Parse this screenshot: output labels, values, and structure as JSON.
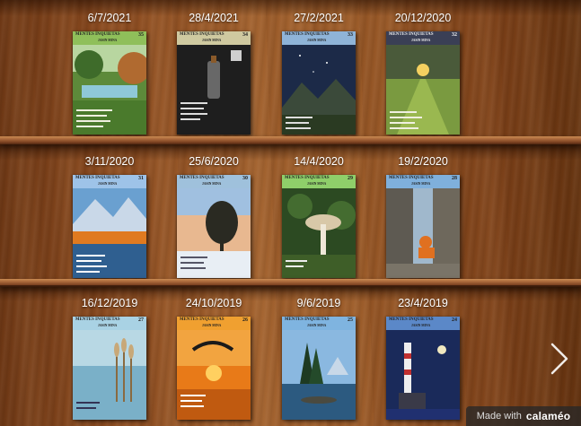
{
  "shelves": [
    {
      "books": [
        {
          "date": "6/7/2021",
          "title": "MENTES INQUIETAS",
          "author": "JASIN MINA",
          "number": "35",
          "head": "#8fbf5a",
          "scene": "garden"
        },
        {
          "date": "28/4/2021",
          "title": "MENTES INQUIETAS",
          "author": "JASIN MINA",
          "number": "34",
          "head": "#cfc9a0",
          "scene": "bottle"
        },
        {
          "date": "27/2/2021",
          "title": "MENTES INQUIETAS",
          "author": "JASIN MINA",
          "number": "33",
          "head": "#8fb4d8",
          "scene": "mountains-night"
        },
        {
          "date": "20/12/2020",
          "title": "MENTES INQUIETAS",
          "author": "JASIN MINA",
          "number": "32",
          "head": "#3a3f55",
          "scene": "field-sunset"
        }
      ]
    },
    {
      "books": [
        {
          "date": "3/11/2020",
          "title": "MENTES INQUIETAS",
          "author": "JASIN MINA",
          "number": "31",
          "head": "#9ec3e8",
          "scene": "autumn-lake"
        },
        {
          "date": "25/6/2020",
          "title": "MENTES INQUIETAS",
          "author": "JASIN MINA",
          "number": "30",
          "head": "#9fc1dc",
          "scene": "winter-tree"
        },
        {
          "date": "14/4/2020",
          "title": "MENTES INQUIETAS",
          "author": "JASIN MINA",
          "number": "29",
          "head": "#8fcf6a",
          "scene": "mushroom"
        },
        {
          "date": "19/2/2020",
          "title": "MENTES INQUIETAS",
          "author": "JASIN MINA",
          "number": "28",
          "head": "#7fb0dc",
          "scene": "monk-rock"
        }
      ]
    },
    {
      "books": [
        {
          "date": "16/12/2019",
          "title": "MENTES INQUIETAS",
          "author": "JASIN MINA",
          "number": "27",
          "head": "#a9d2e4",
          "scene": "reeds"
        },
        {
          "date": "24/10/2019",
          "title": "MENTES INQUIETAS",
          "author": "JASIN MINA",
          "number": "26",
          "head": "#f0a030",
          "scene": "paraglider"
        },
        {
          "date": "9/6/2019",
          "title": "MENTES INQUIETAS",
          "author": "JASIN MINA",
          "number": "25",
          "head": "#7fb4e0",
          "scene": "pine-lake"
        },
        {
          "date": "23/4/2019",
          "title": "MENTES INQUIETAS",
          "author": "JASIN MINA",
          "number": "24",
          "head": "#5b88c8",
          "scene": "lighthouse"
        }
      ]
    }
  ],
  "navigation": {
    "next_icon": "chevron-right-icon"
  },
  "badge": {
    "made_with": "Made with",
    "brand": "calaméo"
  }
}
